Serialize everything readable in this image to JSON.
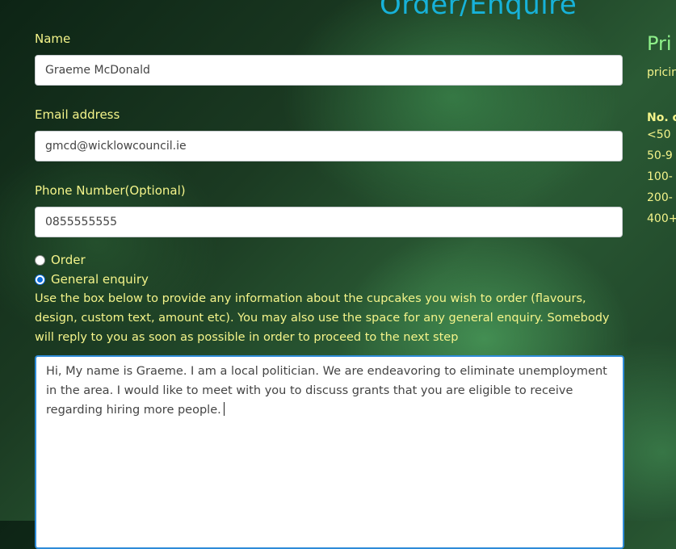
{
  "header": {
    "title": "Order/Enquire"
  },
  "form": {
    "name_label": "Name",
    "name_value": "Graeme McDonald",
    "email_label": "Email address",
    "email_value": "gmcd@wicklowcouncil.ie",
    "phone_label": "Phone Number(Optional)",
    "phone_value": "0855555555",
    "radio_order_label": "Order",
    "radio_enquiry_label": "General enquiry",
    "selected_option": "General enquiry",
    "help_text": "Use the box below to provide any information about the cupcakes you wish to order (flavours, design, custom text, amount etc). You may also use the space for any general enquiry. Somebody will reply to you as soon as possible in order to proceed to the next step",
    "message_value": "Hi, My name is Graeme. I am a local politician. We are endeavoring to eliminate unemployment in the area. I would like to meet with you to discuss grants that you are eligible to receive regarding hiring more people."
  },
  "pricing": {
    "title": "Pri",
    "subtitle": "pricin",
    "column_header": "No. c",
    "rows": [
      "<50",
      "50-9",
      "100-",
      "200-",
      "400+"
    ]
  },
  "colors": {
    "title": "#17b2d9",
    "label": "#f4f48a",
    "pricing_title": "#8ef08a",
    "focus_border": "#2e8bd8"
  }
}
